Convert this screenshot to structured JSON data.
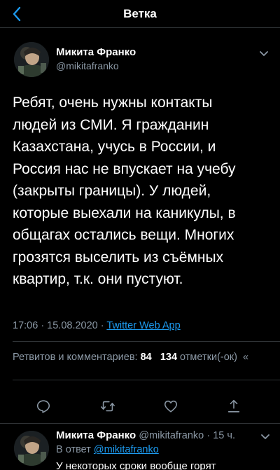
{
  "header": {
    "title": "Ветка",
    "back_icon": "chevron-left-icon"
  },
  "colors": {
    "background": "#000000",
    "accent": "#1d9bf0",
    "secondary_text": "#8b98a5",
    "divider": "#2f3336"
  },
  "tweet": {
    "author_name": "Микита Франко",
    "author_handle": "@mikitafranko",
    "text": "Ребят, очень нужны контакты\nлюдей из СМИ.  Я гражданин\nКазахстана, учусь в России, и\nРоссия нас не впускает на учебу\n(закрыты границы). У людей,\nкоторые выехали на каникулы, в\nобщагах остались вещи. Многих\nгрозятся выселить из съёмных\nквартир, т.к. они пустуют.",
    "timestamp": "17:06 · 15.08.2020 · ",
    "source_app": "Twitter Web App",
    "stats": {
      "retweets_label": "Ретвитов и комментариев: ",
      "retweets_count": "84",
      "likes_count": "134",
      "likes_label": " отметки(-ок)",
      "overflow": "«"
    },
    "actions": {
      "reply_icon": "comment-icon",
      "retweet_icon": "retweet-icon",
      "like_icon": "heart-icon",
      "share_icon": "share-icon"
    }
  },
  "reply": {
    "author_name": "Микита Франко",
    "author_handle": "@mikitafranko",
    "time": "· 15 ч.",
    "reply_to_label": "В ответ ",
    "reply_to_mention": "@mikitafranko",
    "text": "У некоторых сроки вообще горят"
  }
}
